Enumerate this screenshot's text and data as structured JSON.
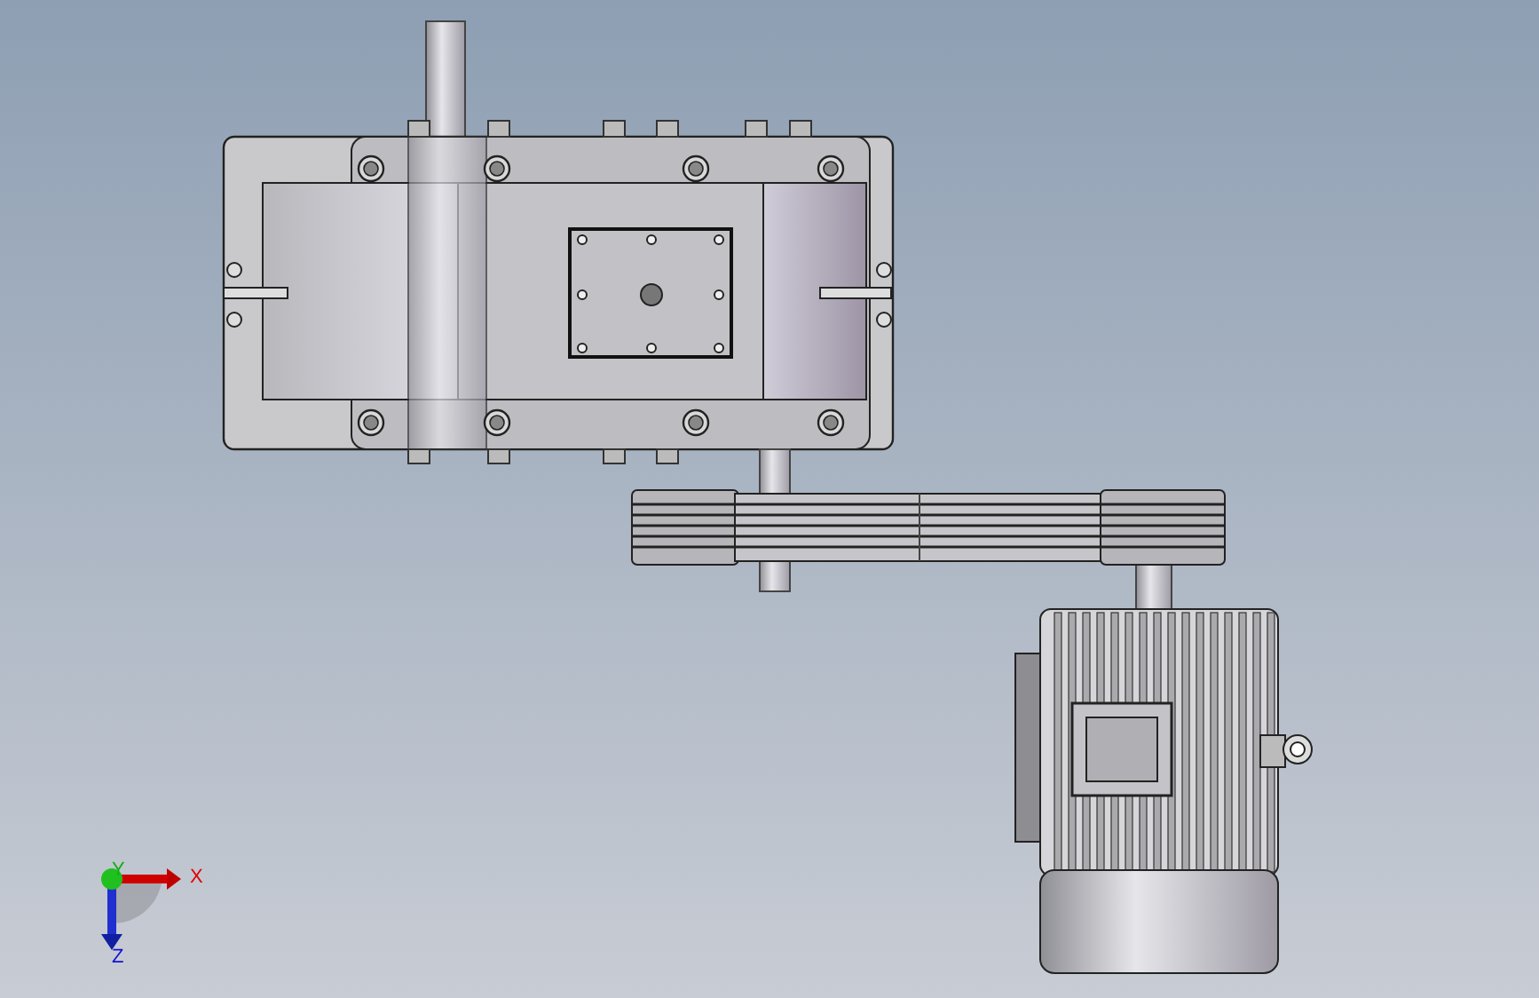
{
  "triad": {
    "labels": [
      {
        "kind": "x",
        "text": "X"
      },
      {
        "kind": "y",
        "text": "Y"
      },
      {
        "kind": "z",
        "text": "Z"
      }
    ]
  }
}
